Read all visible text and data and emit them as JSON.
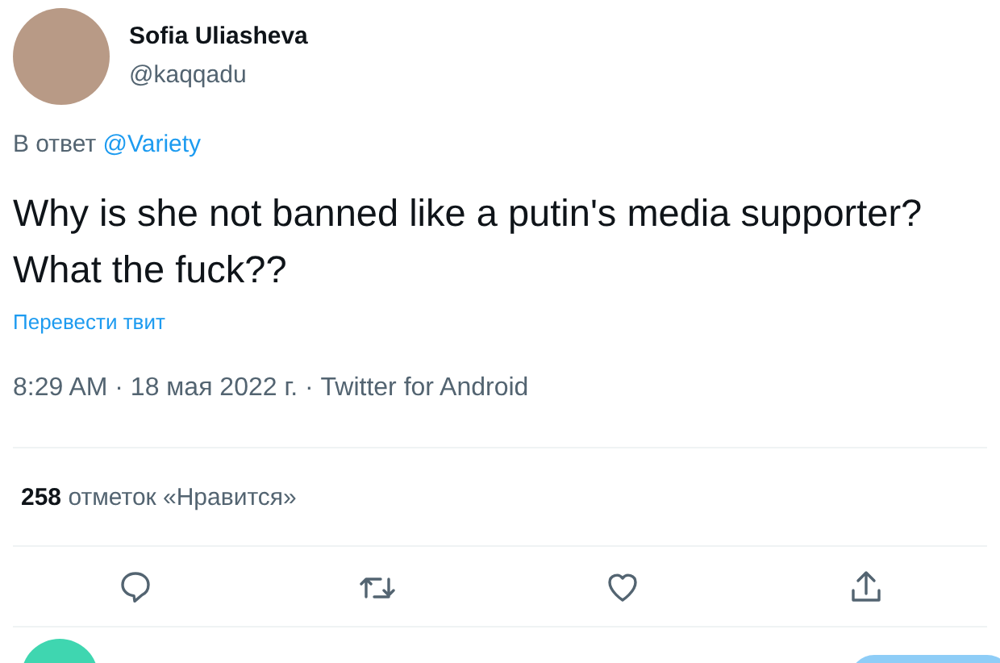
{
  "author": {
    "name": "Sofia Uliasheva",
    "handle": "@kaqqadu"
  },
  "reply_to": {
    "prefix": "В ответ",
    "mention": "@Variety"
  },
  "tweet_lines": [
    "Why is she not banned like a putin's media supporter?",
    "What the fuck??"
  ],
  "translate_link": "Перевести твит",
  "meta": "8:29 AM · 18 мая 2022 г. · Twitter for Android",
  "likes": {
    "count": "258",
    "label": "отметок «Нравится»"
  },
  "actions": [
    {
      "kind": "reply"
    },
    {
      "kind": "retweet"
    },
    {
      "kind": "like"
    },
    {
      "kind": "share"
    }
  ]
}
